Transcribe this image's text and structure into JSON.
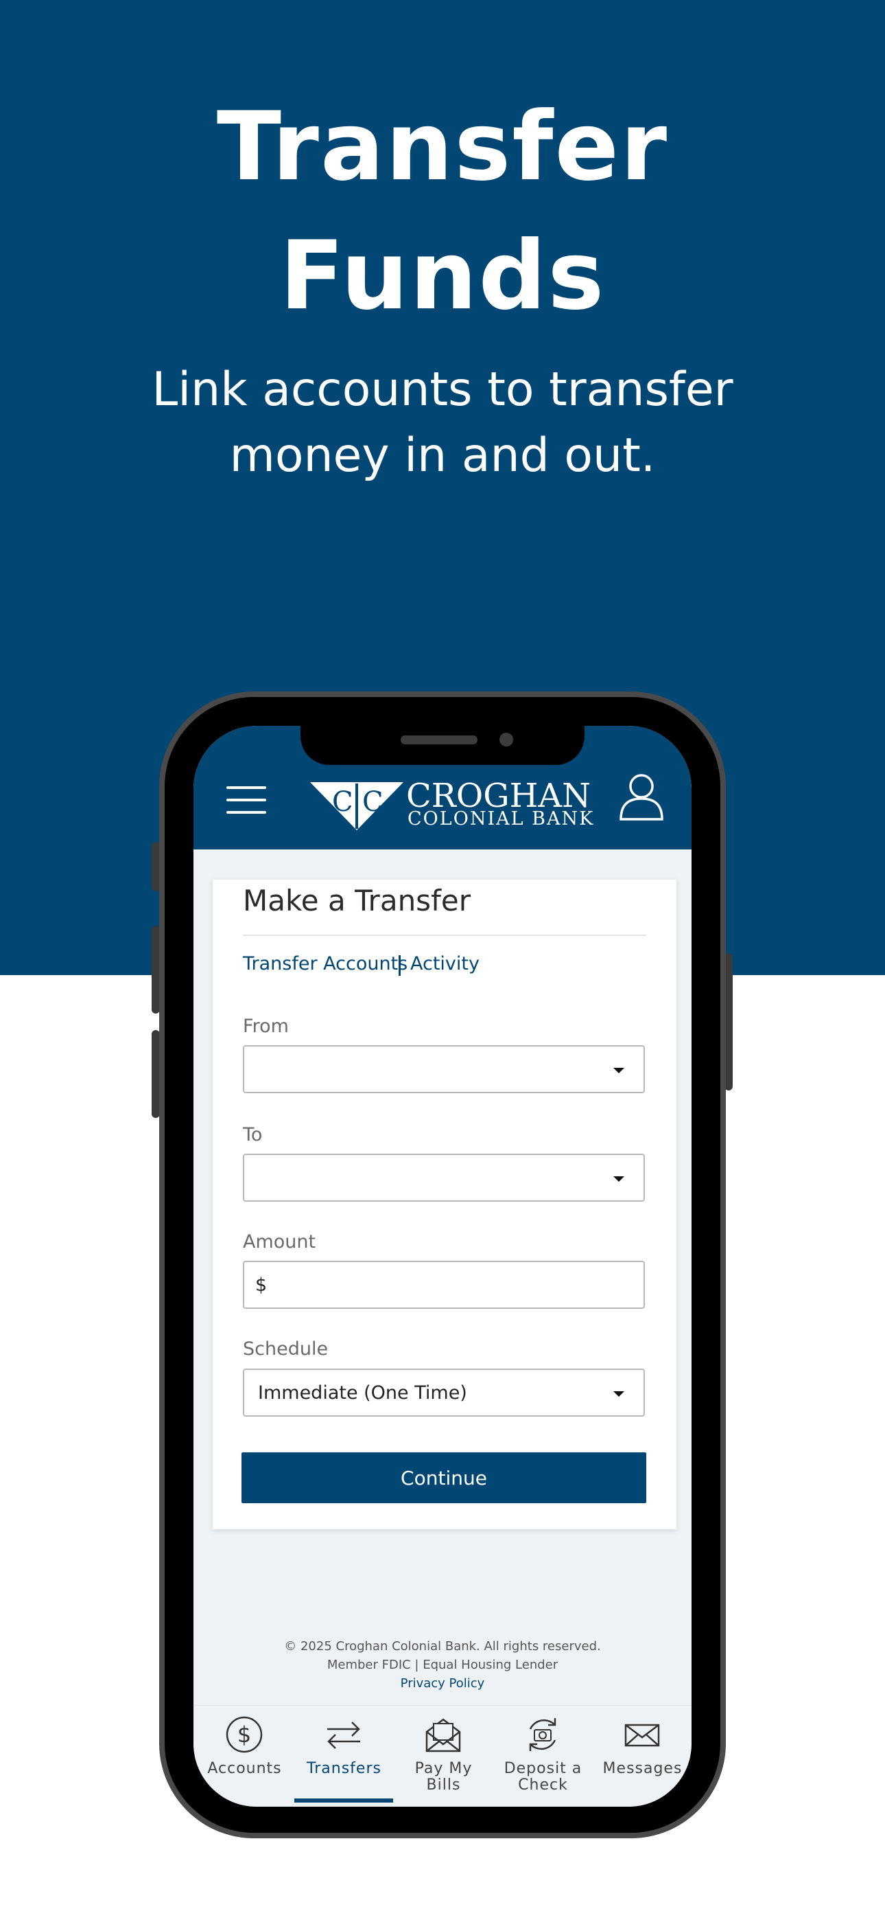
{
  "hero": {
    "title_line1": "Transfer",
    "title_line2": "Funds",
    "subtitle_line1": "Link accounts to transfer",
    "subtitle_line2": "money in and out."
  },
  "header": {
    "logo_name": "CROGHAN",
    "logo_sub": "COLONIAL BANK",
    "logo_letters": "CC"
  },
  "transfer": {
    "title": "Make a Transfer",
    "tabs": [
      "Transfer Accounts",
      "Activity"
    ],
    "from": {
      "label": "From",
      "value": ""
    },
    "to": {
      "label": "To",
      "value": ""
    },
    "amount": {
      "label": "Amount",
      "prefix": "$"
    },
    "schedule": {
      "label": "Schedule",
      "value": "Immediate (One Time)"
    },
    "continue_label": "Continue"
  },
  "footer": {
    "copyright": "© 2025 Croghan Colonial Bank. All rights reserved.",
    "member": "Member FDIC | Equal Housing Lender",
    "privacy": "Privacy Policy"
  },
  "tabbar": [
    {
      "label_line1": "Accounts",
      "label_line2": "",
      "icon": "dollar-circle-icon"
    },
    {
      "label_line1": "Transfers",
      "label_line2": "",
      "icon": "transfer-arrows-icon",
      "active": true
    },
    {
      "label_line1": "Pay My",
      "label_line2": "Bills",
      "icon": "envelope-bill-icon"
    },
    {
      "label_line1": "Deposit a",
      "label_line2": "Check",
      "icon": "camera-refresh-icon"
    },
    {
      "label_line1": "Messages",
      "label_line2": "",
      "icon": "mail-icon"
    }
  ],
  "colors": {
    "brand": "#024673",
    "background": "#eff2f5"
  }
}
